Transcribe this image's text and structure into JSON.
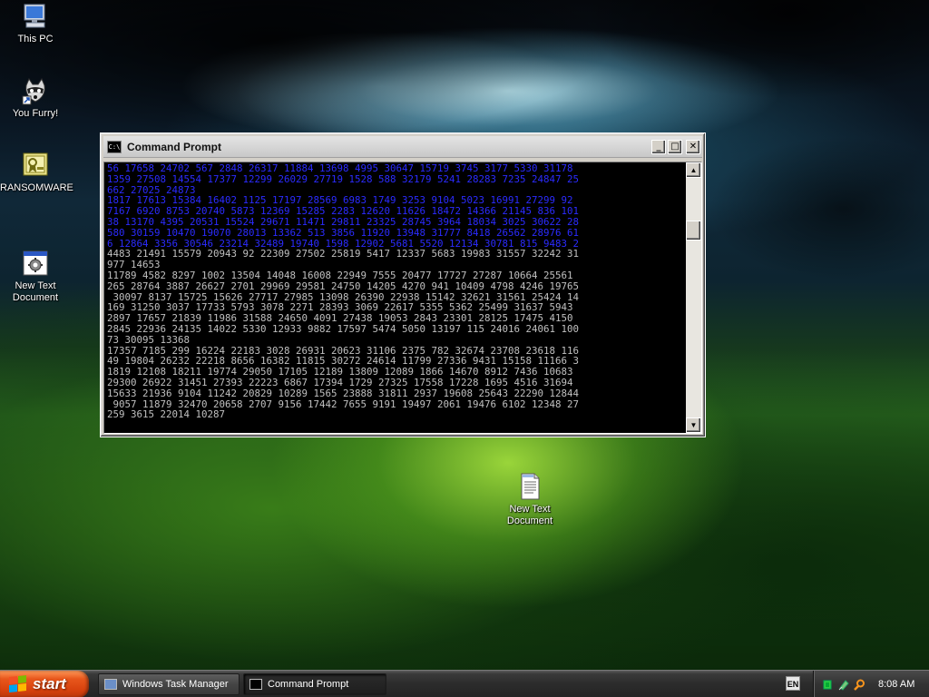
{
  "desktop": {
    "icons": [
      {
        "label": "This PC",
        "icon": "computer-icon"
      },
      {
        "label": "You Furry!",
        "icon": "raccoon-shortcut-icon"
      },
      {
        "label": "RANSOMWARE",
        "icon": "certificate-icon"
      },
      {
        "label": "New Text\nDocument",
        "icon": "batch-file-icon"
      },
      {
        "label": "New Text\nDocument",
        "icon": "text-document-icon"
      }
    ]
  },
  "window": {
    "title": "Command Prompt",
    "icon": "cmd-icon",
    "buttons": {
      "minimize": "_",
      "maximize": "□",
      "close": "✕"
    },
    "console_lines_blue": [
      "56 17658 24702 567 2848 26317 11884 13698 4995 30647 15719 3745 3177 5330 31178 ",
      "1359 27508 14554 17377 12299 26029 27719 1528 588 32179 5241 28283 7235 24847 25",
      "662 27025 24873",
      "1817 17613 15384 16402 1125 17197 28569 6983 1749 3253 9104 5023 16991 27299 92",
      "7167 6920 8753 20740 5873 12369 15285 2283 12620 11626 18472 14366 21145 836 101",
      "38 13170 4395 20531 15524 29671 11471 29811 23325 28745 3964 18034 3025 30622 28",
      "580 30159 10470 19070 28013 13362 513 3856 11920 13948 31777 8418 26562 28976 61",
      "6 12864 3356 30546 23214 32489 19740 1598 12902 5681 5520 12134 30781 815 9483 2"
    ],
    "console_lines_gray": [
      "4483 21491 15579 20943 92 22309 27502 25819 5417 12337 5683 19983 31557 32242 31",
      "977 14653",
      "11789 4582 8297 1002 13504 14048 16008 22949 7555 20477 17727 27287 10664 25561 ",
      "265 28764 3887 26627 2701 29969 29581 24750 14205 4270 941 10409 4798 4246 19765",
      " 30097 8137 15725 15626 27717 27985 13098 26390 22938 15142 32621 31561 25424 14",
      "169 31250 3037 17733 5793 3078 2271 28393 3069 22617 5355 5362 25499 31637 5943 ",
      "2897 17657 21839 11986 31588 24650 4091 27438 19053 2843 23301 28125 17475 4150 ",
      "2845 22936 24135 14022 5330 12933 9882 17597 5474 5050 13197 115 24016 24061 100",
      "73 30095 13368",
      "17357 7185 299 16224 22183 3028 26931 20623 31106 2375 782 32674 23708 23618 116",
      "49 19804 26232 22218 8656 16382 11815 30272 24614 11799 27336 9431 15158 11166 3",
      "1819 12108 18211 19774 29050 17105 12189 13809 12089 1866 14670 8912 7436 10683 ",
      "29300 26922 31451 27393 22223 6867 17394 1729 27325 17558 17228 1695 4516 31694 ",
      "15633 21936 9104 11242 20829 10289 1565 23888 31811 2937 19608 25643 22290 12844",
      " 9057 11879 32470 20658 2707 9156 17442 7655 9191 19497 2061 19476 6102 12348 27",
      "259 3615 22014 10287"
    ]
  },
  "taskbar": {
    "start_label": "start",
    "tasks": [
      {
        "label": "Windows Task Manager",
        "icon": "task-manager-icon",
        "active": false
      },
      {
        "label": "Command Prompt",
        "icon": "cmd-icon",
        "active": true
      }
    ],
    "language": "EN",
    "tray_icons": [
      "network-icon",
      "safely-remove-icon",
      "search-icon"
    ],
    "clock": "8:08 AM"
  }
}
